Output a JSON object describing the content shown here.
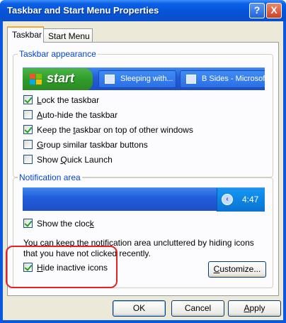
{
  "window": {
    "title": "Taskbar and Start Menu Properties",
    "help_label": "?",
    "close_label": "X"
  },
  "tabs": [
    {
      "label": "Taskbar",
      "active": true
    },
    {
      "label": "Start Menu",
      "active": false
    }
  ],
  "appearance": {
    "title": "Taskbar appearance",
    "preview": {
      "start_label": "start",
      "tasks": [
        "Sleeping with...",
        "B Sides - Microsof"
      ]
    },
    "options": [
      {
        "pre": "",
        "key": "L",
        "post": "ock the taskbar",
        "checked": true
      },
      {
        "pre": "",
        "key": "A",
        "post": "uto-hide the taskbar",
        "checked": false
      },
      {
        "pre": "Keep the ",
        "key": "t",
        "post": "askbar on top of other windows",
        "checked": true
      },
      {
        "pre": "",
        "key": "G",
        "post": "roup similar taskbar buttons",
        "checked": false
      },
      {
        "pre": "Show ",
        "key": "Q",
        "post": "uick Launch",
        "checked": false
      }
    ]
  },
  "notification": {
    "title": "Notification area",
    "preview": {
      "clock": "4:47"
    },
    "show_clock": {
      "pre": "Show the cloc",
      "key": "k",
      "post": "",
      "checked": true
    },
    "description": "You can keep the notification area uncluttered by hiding icons that you have not clicked recently.",
    "hide_inactive": {
      "pre": "",
      "key": "H",
      "post": "ide inactive icons",
      "checked": true
    },
    "customize": {
      "pre": "",
      "key": "C",
      "post": "ustomize..."
    }
  },
  "buttons": {
    "ok": "OK",
    "cancel": "Cancel",
    "apply": {
      "pre": "",
      "key": "A",
      "post": "pply"
    }
  },
  "colors": {
    "accent": "#0046d5",
    "highlight_ring": "#e8202a",
    "titlebar": "#0553d6"
  }
}
